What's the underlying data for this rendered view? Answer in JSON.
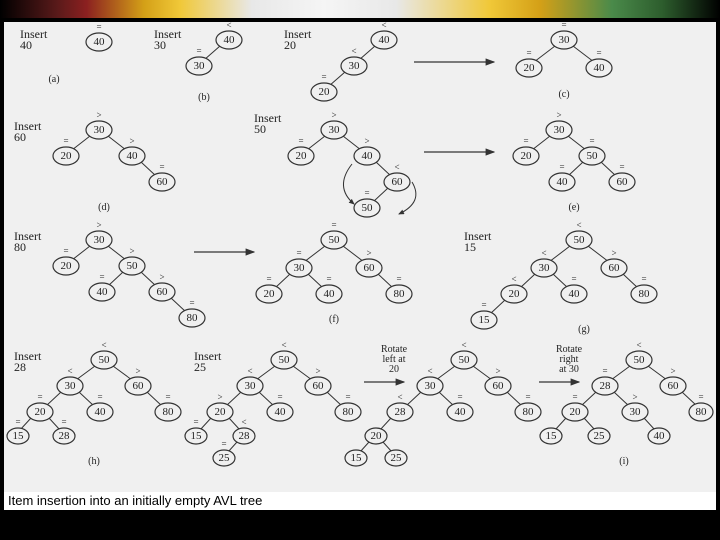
{
  "caption": "Item insertion into an initially empty AVL tree",
  "labels": {
    "a": "(a)",
    "b": "(b)",
    "c": "(c)",
    "d": "(d)",
    "e": "(e)",
    "f": "(f)",
    "g": "(g)",
    "h": "(h)",
    "i": "(i)"
  },
  "ops": {
    "ins40": "Insert\n40",
    "ins30": "Insert\n30",
    "ins20": "Insert\n20",
    "ins60": "Insert\n60",
    "ins50": "Insert\n50",
    "ins80": "Insert\n80",
    "ins15": "Insert\n15",
    "ins28": "Insert\n28",
    "ins25": "Insert\n25",
    "rotL20": "Rotate\nleft at\n20",
    "rotR30": "Rotate\nright\nat 30"
  },
  "values": [
    "40",
    "30",
    "20",
    "60",
    "50",
    "80",
    "15",
    "28",
    "25"
  ],
  "bf": {
    "eq": "=",
    "lt": "<",
    "gt": ">"
  },
  "chart_data": [
    {
      "step": "a",
      "op": "Insert 40",
      "tree": {
        "v": 40,
        "bf": "="
      }
    },
    {
      "step": "b",
      "op": "Insert 30",
      "tree": {
        "v": 40,
        "bf": "<",
        "l": {
          "v": 30,
          "bf": "="
        }
      }
    },
    {
      "step": "c_before",
      "op": "Insert 20",
      "tree": {
        "v": 40,
        "bf": "<",
        "l": {
          "v": 30,
          "bf": "<",
          "l": {
            "v": 20,
            "bf": "="
          }
        }
      }
    },
    {
      "step": "c_after",
      "op": "rotated",
      "tree": {
        "v": 30,
        "bf": "=",
        "l": {
          "v": 20,
          "bf": "="
        },
        "r": {
          "v": 40,
          "bf": "="
        }
      }
    },
    {
      "step": "d",
      "op": "Insert 60",
      "tree": {
        "v": 30,
        "bf": ">",
        "l": {
          "v": 20,
          "bf": "="
        },
        "r": {
          "v": 40,
          "bf": ">",
          "r": {
            "v": 60,
            "bf": "="
          }
        }
      }
    },
    {
      "step": "e_before",
      "op": "Insert 50",
      "tree": {
        "v": 30,
        "bf": ">",
        "l": {
          "v": 20,
          "bf": "="
        },
        "r": {
          "v": 40,
          "bf": ">",
          "r": {
            "v": 60,
            "bf": "<",
            "l": {
              "v": 50,
              "bf": "="
            }
          }
        }
      }
    },
    {
      "step": "e_after",
      "op": "rotated",
      "tree": {
        "v": 30,
        "bf": ">",
        "l": {
          "v": 20,
          "bf": "="
        },
        "r": {
          "v": 50,
          "bf": "=",
          "l": {
            "v": 40,
            "bf": "="
          },
          "r": {
            "v": 60,
            "bf": "="
          }
        }
      }
    },
    {
      "step": "f_before",
      "op": "Insert 80",
      "tree": {
        "v": 30,
        "bf": ">",
        "l": {
          "v": 20,
          "bf": "="
        },
        "r": {
          "v": 50,
          "bf": ">",
          "l": {
            "v": 40,
            "bf": "="
          },
          "r": {
            "v": 60,
            "bf": ">",
            "r": {
              "v": 80,
              "bf": "="
            }
          }
        }
      }
    },
    {
      "step": "f_after",
      "op": "rotated",
      "tree": {
        "v": 50,
        "bf": "=",
        "l": {
          "v": 30,
          "bf": "=",
          "l": {
            "v": 20,
            "bf": "="
          },
          "r": {
            "v": 40,
            "bf": "="
          }
        },
        "r": {
          "v": 60,
          "bf": ">",
          "r": {
            "v": 80,
            "bf": "="
          }
        }
      }
    },
    {
      "step": "g",
      "op": "Insert 15",
      "tree": {
        "v": 50,
        "bf": "<",
        "l": {
          "v": 30,
          "bf": "<",
          "l": {
            "v": 20,
            "bf": "<",
            "l": {
              "v": 15,
              "bf": "="
            }
          },
          "r": {
            "v": 40,
            "bf": "="
          }
        },
        "r": {
          "v": 60,
          "bf": ">",
          "r": {
            "v": 80,
            "bf": "="
          }
        }
      }
    },
    {
      "step": "h",
      "op": "Insert 28",
      "tree": {
        "v": 50,
        "bf": "<",
        "l": {
          "v": 30,
          "bf": "<",
          "l": {
            "v": 20,
            "bf": "=",
            "l": {
              "v": 15,
              "bf": "="
            },
            "r": {
              "v": 28,
              "bf": "="
            }
          },
          "r": {
            "v": 40,
            "bf": "="
          }
        },
        "r": {
          "v": 60,
          "bf": ">",
          "r": {
            "v": 80,
            "bf": "="
          }
        }
      }
    },
    {
      "step": "i_s1",
      "op": "Insert 25",
      "tree": {
        "v": 50,
        "bf": "<",
        "l": {
          "v": 30,
          "bf": "<",
          "l": {
            "v": 20,
            "bf": ">",
            "l": {
              "v": 15,
              "bf": "="
            },
            "r": {
              "v": 28,
              "bf": "<",
              "l": {
                "v": 25,
                "bf": "="
              }
            }
          },
          "r": {
            "v": 40,
            "bf": "="
          }
        },
        "r": {
          "v": 60,
          "bf": ">",
          "r": {
            "v": 80,
            "bf": "="
          }
        }
      }
    },
    {
      "step": "i_s2",
      "op": "Rotate left at 20",
      "tree": {
        "v": 50,
        "bf": "<",
        "l": {
          "v": 30,
          "bf": "<",
          "l": {
            "v": 28,
            "bf": "<",
            "l": {
              "v": 20,
              "bf": "=",
              "l": {
                "v": 15,
                "bf": "="
              },
              "r": {
                "v": 25,
                "bf": "="
              }
            }
          },
          "r": {
            "v": 40,
            "bf": "="
          }
        },
        "r": {
          "v": 60,
          "bf": ">",
          "r": {
            "v": 80,
            "bf": "="
          }
        }
      }
    },
    {
      "step": "i_s3",
      "op": "Rotate right at 30",
      "tree": {
        "v": 50,
        "bf": "<",
        "l": {
          "v": 28,
          "bf": "=",
          "l": {
            "v": 20,
            "bf": "=",
            "l": {
              "v": 15,
              "bf": "="
            },
            "r": {
              "v": 25,
              "bf": "="
            }
          },
          "r": {
            "v": 30,
            "bf": ">",
            "r": {
              "v": 40,
              "bf": "="
            }
          }
        },
        "r": {
          "v": 60,
          "bf": ">",
          "r": {
            "v": 80,
            "bf": "="
          }
        }
      }
    }
  ]
}
